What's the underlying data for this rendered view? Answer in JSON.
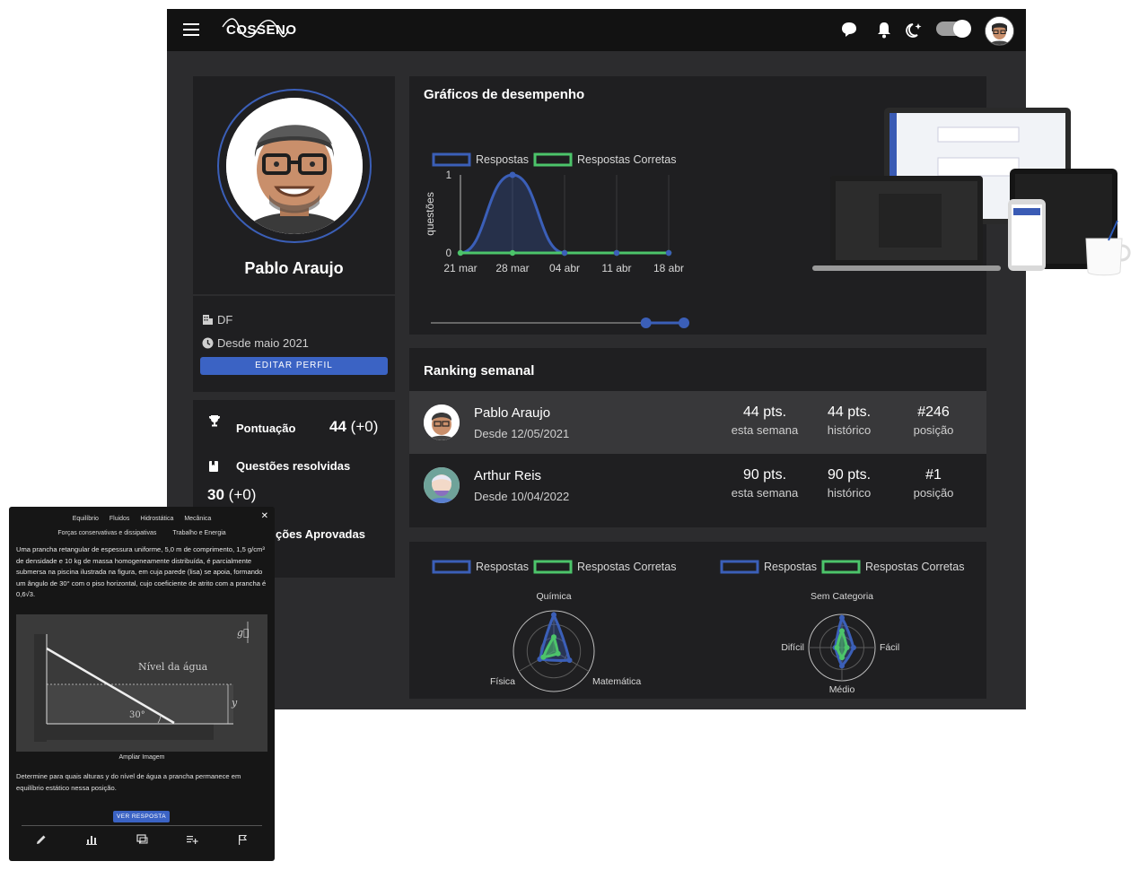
{
  "topbar": {
    "logo_text": "COSSENO",
    "icons": [
      "menu-icon",
      "chat-icon",
      "bell-icon",
      "moon-star-icon"
    ],
    "theme_toggle": "on"
  },
  "profile": {
    "name": "Pablo Araujo",
    "location": "DF",
    "since": "Desde maio 2021",
    "edit_label": "EDITAR PERFIL"
  },
  "stats": {
    "score_label": "Pontuação",
    "score_value": "44",
    "score_delta": "(+0)",
    "solved_label": "Questões resolvidas",
    "solved_value": "30",
    "solved_delta": "(+0)",
    "approved_label": "ções Aprovadas"
  },
  "performance": {
    "title": "Gráficos de desempenho",
    "legend_answers": "Respostas",
    "legend_correct": "Respostas Corretas",
    "ylabel": "questões"
  },
  "chart_data": [
    {
      "type": "line",
      "categories": [
        "21 mar",
        "28 mar",
        "04 abr",
        "11 abr",
        "18 abr"
      ],
      "ylim": [
        0,
        1
      ],
      "y_ticks": [
        "0",
        "1"
      ],
      "series": [
        {
          "name": "Respostas",
          "values": [
            0,
            1,
            0,
            0,
            0
          ],
          "color": "#3b5fb8"
        },
        {
          "name": "Respostas Corretas",
          "values": [
            0,
            0,
            0,
            0,
            0
          ],
          "color": "#4cc46a"
        }
      ],
      "ylabel": "questões",
      "legend": "top",
      "range_slider": [
        0.85,
        1.0
      ]
    },
    {
      "type": "radar",
      "axes": [
        "Química",
        "Matemática",
        "Física"
      ],
      "series": [
        {
          "name": "Respostas",
          "values": [
            0.9,
            0.45,
            0.4
          ],
          "color": "#3b5fb8"
        },
        {
          "name": "Respostas Corretas",
          "values": [
            0.35,
            0.12,
            0.3
          ],
          "color": "#4cc46a"
        }
      ]
    },
    {
      "type": "radar",
      "axes": [
        "Sem Categoria",
        "Fácil",
        "Médio",
        "Difícil"
      ],
      "series": [
        {
          "name": "Respostas",
          "values": [
            0.9,
            0.35,
            0.55,
            0.2
          ],
          "color": "#3b5fb8"
        },
        {
          "name": "Respostas Corretas",
          "values": [
            0.5,
            0.15,
            0.3,
            0.15
          ],
          "color": "#4cc46a"
        }
      ]
    }
  ],
  "ranking": {
    "title": "Ranking semanal",
    "rows": [
      {
        "name": "Pablo Araujo",
        "since": "Desde 12/05/2021",
        "week_pts": "44 pts.",
        "week_label": "esta semana",
        "hist_pts": "44 pts.",
        "hist_label": "histórico",
        "pos": "#246",
        "pos_label": "posição"
      },
      {
        "name": "Arthur Reis",
        "since": "Desde 10/04/2022",
        "week_pts": "90 pts.",
        "week_label": "esta semana",
        "hist_pts": "90 pts.",
        "hist_label": "histórico",
        "pos": "#1",
        "pos_label": "posição"
      }
    ]
  },
  "radar": {
    "legend_answers": "Respostas",
    "legend_correct": "Respostas Corretas",
    "left_axes": {
      "top": "Química",
      "right": "Matemática",
      "left": "Física"
    },
    "right_axes": {
      "top": "Sem Categoria",
      "right": "Fácil",
      "bottom": "Médio",
      "left": "Difícil"
    }
  },
  "mobile": {
    "tabs_row1": [
      "Equilíbrio",
      "Fluidos",
      "Hidrostática",
      "Mecânica"
    ],
    "tabs_row2": [
      "Forças conservativas e dissipativas",
      "Trabalho e Energia"
    ],
    "problem_text": "Uma prancha retangular de espessura uniforme, 5,0 m de comprimento, 1,5 g/cm³ de densidade e 10 kg de massa homogeneamente distribuída, é parcialmente submersa na piscina ilustrada na figura, em cuja parede (lisa) se apoia, formando um ângulo de 30° com o piso horizontal, cujo coeficiente de atrito com a prancha é 0,6√3.",
    "figure_water_label": "Nível da água",
    "figure_angle": "30°",
    "figure_y": "y",
    "figure_g": "g⃗",
    "zoom_label": "Ampliar Imagem",
    "question_text": "Determine para quais alturas y do nível de água a prancha permanece em equilíbrio estático nessa posição.",
    "answer_button": "VER RESPOSTA",
    "bottom_icons": [
      "pencil-icon",
      "bar-chart-icon",
      "comments-icon",
      "playlist-add-icon",
      "flag-icon"
    ]
  }
}
